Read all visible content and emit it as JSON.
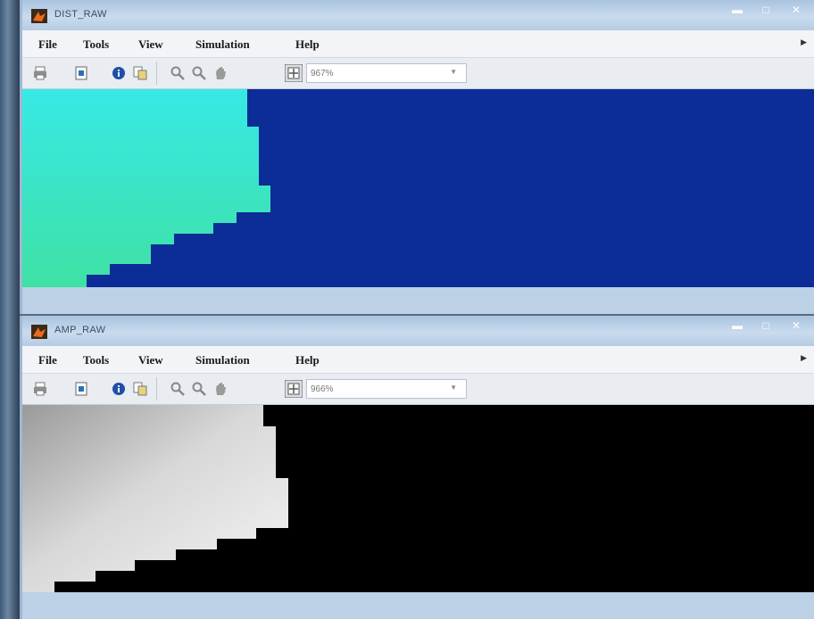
{
  "windows": [
    {
      "title": "DIST_RAW",
      "menu": [
        "File",
        "Tools",
        "View",
        "Simulation",
        "Help"
      ],
      "zoom": "967%",
      "colors": {
        "background": "#0c2c97",
        "region_top": "#37e9e6",
        "region_bottom": "#3ee1a4"
      }
    },
    {
      "title": "AMP_RAW",
      "menu": [
        "File",
        "Tools",
        "View",
        "Simulation",
        "Help"
      ],
      "zoom": "966%",
      "colors": {
        "background": "#000000",
        "region_top": "#9a9a9a",
        "region_bottom": "#f2f2f2"
      }
    }
  ],
  "icons": [
    "print-icon",
    "save-icon",
    "info-icon",
    "copy-icon",
    "zoom-in-icon",
    "zoom-out-icon",
    "pan-icon",
    "fit-icon"
  ]
}
